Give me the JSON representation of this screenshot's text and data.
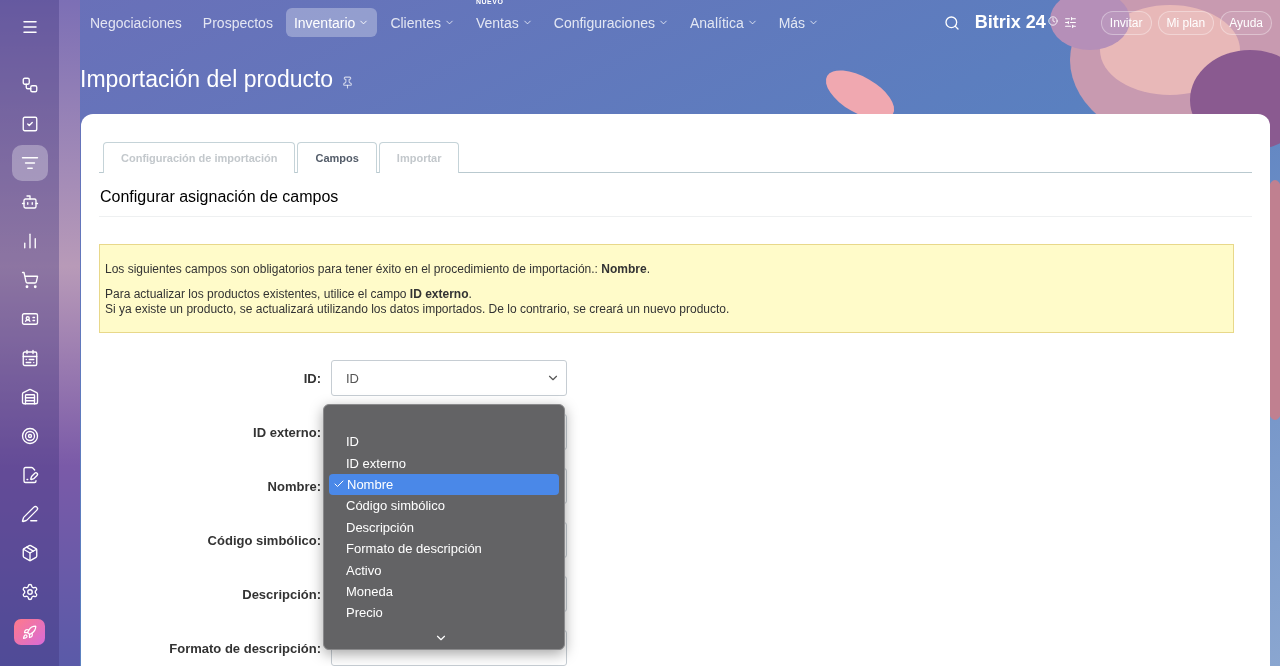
{
  "nav": {
    "items": [
      {
        "label": "Negociaciones",
        "selected": false,
        "has_menu": false
      },
      {
        "label": "Prospectos",
        "selected": false,
        "has_menu": false
      },
      {
        "label": "Inventario",
        "selected": true,
        "has_menu": true
      },
      {
        "label": "Clientes",
        "selected": false,
        "has_menu": true
      },
      {
        "label": "Ventas",
        "selected": false,
        "has_menu": true,
        "badge": "NUEVO"
      },
      {
        "label": "Configuraciones",
        "selected": false,
        "has_menu": true
      },
      {
        "label": "Analítica",
        "selected": false,
        "has_menu": true
      },
      {
        "label": "Más",
        "selected": false,
        "has_menu": true
      }
    ],
    "logo": "Bitrix 24",
    "buttons": [
      "Invitar",
      "Mi plan",
      "Ayuda"
    ]
  },
  "sidebar": {
    "items": [
      {
        "selected": false
      },
      {
        "selected": false
      },
      {
        "selected": true
      },
      {
        "selected": false
      },
      {
        "selected": false
      },
      {
        "selected": false
      },
      {
        "selected": false
      },
      {
        "selected": false
      },
      {
        "selected": false
      },
      {
        "selected": false
      },
      {
        "selected": false
      },
      {
        "selected": false
      },
      {
        "selected": false
      },
      {
        "selected": false
      }
    ]
  },
  "page_title": "Importación del producto",
  "tabs": [
    {
      "label": "Configuración de importación",
      "selected": false
    },
    {
      "label": "Campos",
      "selected": true
    },
    {
      "label": "Importar",
      "selected": false
    }
  ],
  "section_title": "Configurar asignación de campos",
  "notice": {
    "required": "Los siguientes campos son obligatorios para tener éxito en el procedimiento de importación.: **Nombre**.",
    "update_lines": [
      "Para actualizar los productos existentes, utilice el campo **ID externo**.",
      "Si ya existe un producto, se actualizará utilizando los datos importados. De lo contrario, se creará un nuevo producto."
    ]
  },
  "fields": [
    {
      "label": "ID:",
      "value": "ID"
    },
    {
      "label": "ID externo:"
    },
    {
      "label": "Nombre:"
    },
    {
      "label": "Código simbólico:"
    },
    {
      "label": "Descripción:"
    },
    {
      "label": "Formato de descripción:"
    }
  ],
  "dropdown": {
    "options": [
      {
        "label": "ID",
        "selected": false
      },
      {
        "label": "ID externo",
        "selected": false
      },
      {
        "label": "Nombre",
        "selected": true
      },
      {
        "label": "Código simbólico",
        "selected": false
      },
      {
        "label": "Descripción",
        "selected": false
      },
      {
        "label": "Formato de descripción",
        "selected": false
      },
      {
        "label": "Activo",
        "selected": false
      },
      {
        "label": "Moneda",
        "selected": false
      },
      {
        "label": "Precio",
        "selected": false
      }
    ]
  }
}
